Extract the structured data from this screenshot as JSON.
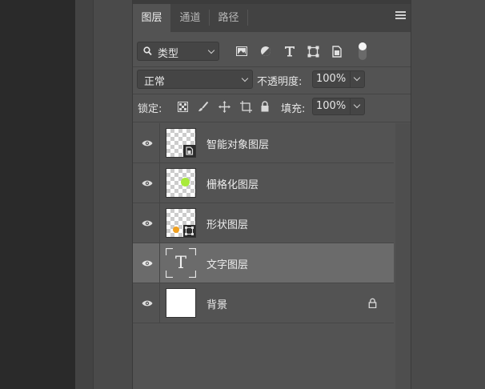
{
  "panel": {
    "tabs": [
      {
        "label": "图层",
        "active": true
      },
      {
        "label": "通道",
        "active": false
      },
      {
        "label": "路径",
        "active": false
      }
    ]
  },
  "filter": {
    "kind_label": "类型",
    "icons": [
      "image-filter-icon",
      "adjustment-filter-icon",
      "type-filter-icon",
      "shape-filter-icon",
      "smart-object-filter-icon",
      "filter-toggle"
    ]
  },
  "blend": {
    "mode": "正常",
    "opacity_label": "不透明度:",
    "opacity_value": "100%"
  },
  "lock": {
    "label": "锁定:",
    "icons": [
      "lock-transparent-pixels-icon",
      "lock-image-pixels-icon",
      "lock-position-icon",
      "lock-artboard-icon",
      "lock-all-icon"
    ],
    "fill_label": "填充:",
    "fill_value": "100%"
  },
  "layers": [
    {
      "name": "智能对象图层",
      "type": "smart-object",
      "selected": false
    },
    {
      "name": "栅格化图层",
      "type": "raster",
      "dot_color": "#a8ea3a",
      "selected": false
    },
    {
      "name": "形状图层",
      "type": "shape",
      "dot_color": "#f0a020",
      "selected": false
    },
    {
      "name": "文字图层",
      "type": "text",
      "thumb_glyph": "T",
      "selected": true
    },
    {
      "name": "背景",
      "type": "background",
      "locked": true,
      "selected": false
    }
  ],
  "colors": {
    "panel_bg": "#535353",
    "selected_row": "#6b6b6b",
    "raster_dot": "#a8ea3a",
    "shape_dot": "#f0a020"
  }
}
